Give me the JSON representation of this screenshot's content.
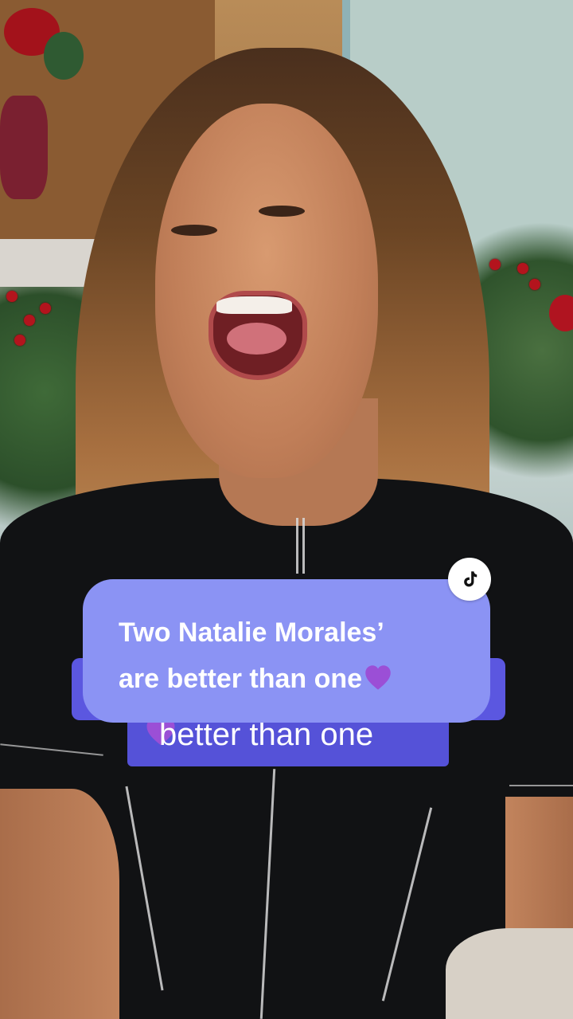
{
  "caption": {
    "line1": "Two Natalie Morales’",
    "line2": "are better than one",
    "heart_icon": "purple-heart-icon",
    "heart_color": "#9b4fd6",
    "background_color": "#8b93f4"
  },
  "secondary_caption": {
    "text": "better than one",
    "background_color": "#5552d8"
  },
  "badge": {
    "icon": "tiktok-icon"
  }
}
